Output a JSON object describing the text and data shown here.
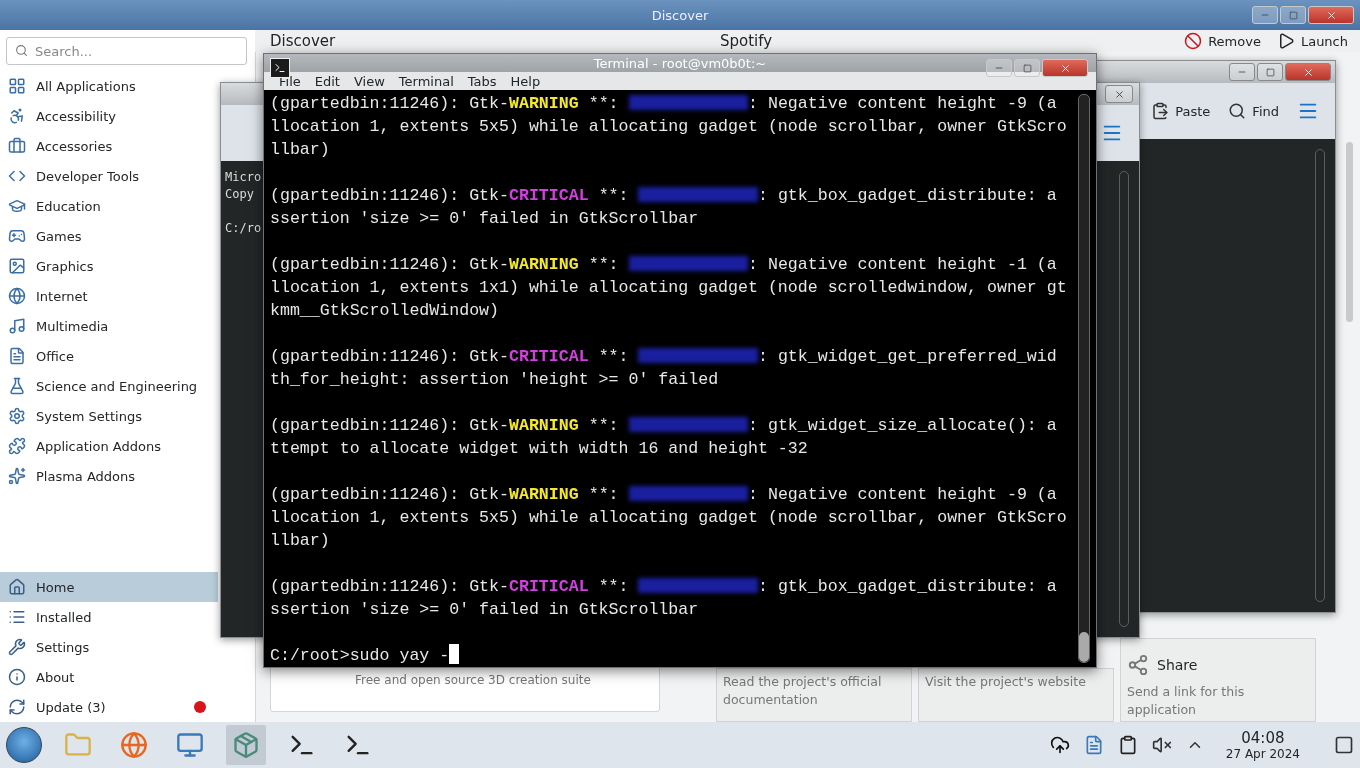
{
  "background_window": {
    "title": "Discover"
  },
  "discover": {
    "search": {
      "placeholder": "Search..."
    },
    "categories": [
      {
        "label": "All Applications"
      },
      {
        "label": "Accessibility"
      },
      {
        "label": "Accessories"
      },
      {
        "label": "Developer Tools"
      },
      {
        "label": "Education"
      },
      {
        "label": "Games"
      },
      {
        "label": "Graphics"
      },
      {
        "label": "Internet"
      },
      {
        "label": "Multimedia"
      },
      {
        "label": "Office"
      },
      {
        "label": "Science and Engineering"
      },
      {
        "label": "System Settings"
      },
      {
        "label": "Application Addons"
      },
      {
        "label": "Plasma Addons"
      }
    ],
    "nav": [
      {
        "label": "Home",
        "selected": true,
        "alert": false
      },
      {
        "label": "Installed",
        "selected": false,
        "alert": false
      },
      {
        "label": "Settings",
        "selected": false,
        "alert": false
      },
      {
        "label": "About",
        "selected": false,
        "alert": false
      },
      {
        "label": "Update (3)",
        "selected": false,
        "alert": true
      }
    ],
    "page_title": "Discover",
    "app_title": "Spotify",
    "actions": [
      {
        "label": "Remove",
        "kind": "remove"
      },
      {
        "label": "Launch",
        "kind": "launch"
      }
    ],
    "addon_card": {
      "description": "Free and open source 3D creation suite"
    },
    "link_cards": [
      {
        "kind": "docs",
        "description": "Read the project's official documentation"
      },
      {
        "kind": "web",
        "description": "Visit the project's website"
      },
      {
        "kind": "share",
        "title": "Share",
        "description": "Send a link for this application"
      }
    ]
  },
  "console_window": {
    "lines": [
      "Micro",
      "Copy",
      "C:/ro"
    ]
  },
  "editor_window": {
    "toolbar": [
      {
        "label": "Paste",
        "kind": "paste"
      },
      {
        "label": "Find",
        "kind": "find"
      }
    ]
  },
  "terminal": {
    "title": "Terminal - root@vm0b0t:~",
    "menu": [
      "File",
      "Edit",
      "View",
      "Terminal",
      "Tabs",
      "Help"
    ],
    "entries": [
      {
        "source": "(gpartedbin:11246): Gtk-",
        "severity": "WARNING",
        "kind": "warning",
        "marks": "**:",
        "message": ": Negative content height -9 (allocation 1, extents 5x5) while allocating gadget (node scrollbar, owner GtkScrollbar)"
      },
      {
        "source": "(gpartedbin:11246): Gtk-",
        "severity": "CRITICAL",
        "kind": "critical",
        "marks": "**:",
        "message": ": gtk_box_gadget_distribute: assertion 'size >= 0' failed in GtkScrollbar"
      },
      {
        "source": "(gpartedbin:11246): Gtk-",
        "severity": "WARNING",
        "kind": "warning",
        "marks": "**:",
        "message": ": Negative content height -1 (allocation 1, extents 1x1) while allocating gadget (node scrolledwindow, owner gtkmm__GtkScrolledWindow)"
      },
      {
        "source": "(gpartedbin:11246): Gtk-",
        "severity": "CRITICAL",
        "kind": "critical",
        "marks": "**:",
        "message": ": gtk_widget_get_preferred_width_for_height: assertion 'height >= 0' failed"
      },
      {
        "source": "(gpartedbin:11246): Gtk-",
        "severity": "WARNING",
        "kind": "warning",
        "marks": "**:",
        "message": ": gtk_widget_size_allocate(): attempt to allocate widget with width 16 and height -32"
      },
      {
        "source": "(gpartedbin:11246): Gtk-",
        "severity": "WARNING",
        "kind": "warning",
        "marks": "**:",
        "message": ": Negative content height -9 (allocation 1, extents 5x5) while allocating gadget (node scrollbar, owner GtkScrollbar)"
      },
      {
        "source": "(gpartedbin:11246): Gtk-",
        "severity": "CRITICAL",
        "kind": "critical",
        "marks": "**:",
        "message": ": gtk_box_gadget_distribute: assertion 'size >= 0' failed in GtkScrollbar"
      }
    ],
    "prompt": "C:/root>sudo yay -"
  },
  "taskbar": {
    "clock": {
      "time": "04:08",
      "date": "27 Apr 2024"
    }
  }
}
